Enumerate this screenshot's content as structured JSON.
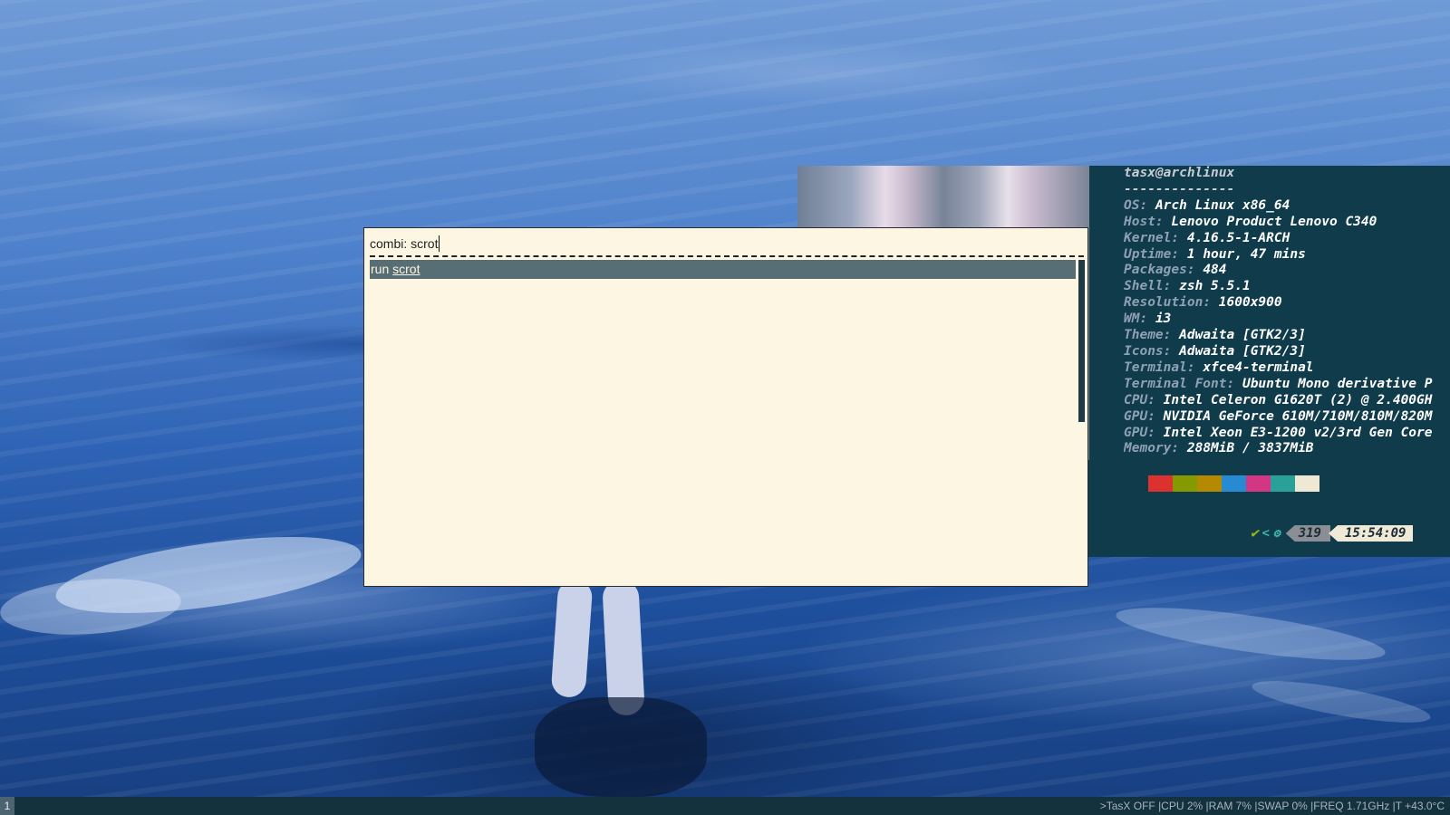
{
  "rofi": {
    "input_prefix": "combi:",
    "input_value": "scrot",
    "result_prefix": "run",
    "result_match": "scrot"
  },
  "terminal": {
    "user_host": "tasx@archlinux",
    "separator": "--------------",
    "info": [
      {
        "key": "OS",
        "value": "Arch Linux x86_64"
      },
      {
        "key": "Host",
        "value": "Lenovo Product Lenovo C340"
      },
      {
        "key": "Kernel",
        "value": "4.16.5-1-ARCH"
      },
      {
        "key": "Uptime",
        "value": "1 hour, 47 mins"
      },
      {
        "key": "Packages",
        "value": "484"
      },
      {
        "key": "Shell",
        "value": "zsh 5.5.1"
      },
      {
        "key": "Resolution",
        "value": "1600x900"
      },
      {
        "key": "WM",
        "value": "i3"
      },
      {
        "key": "Theme",
        "value": "Adwaita [GTK2/3]"
      },
      {
        "key": "Icons",
        "value": "Adwaita [GTK2/3]"
      },
      {
        "key": "Terminal",
        "value": "xfce4-terminal"
      },
      {
        "key": "Terminal Font",
        "value": "Ubuntu Mono derivative P"
      },
      {
        "key": "CPU",
        "value": "Intel Celeron G1620T (2) @ 2.400GH"
      },
      {
        "key": "GPU",
        "value": "NVIDIA GeForce 610M/710M/810M/820M"
      },
      {
        "key": "GPU",
        "value": "Intel Xeon E3-1200 v2/3rd Gen Core"
      },
      {
        "key": "Memory",
        "value": "288MiB / 3837MiB"
      }
    ],
    "colors": [
      "#0f3b4b",
      "#dc322f",
      "#859900",
      "#b58900",
      "#268bd2",
      "#d33682",
      "#2aa198",
      "#eee8d5"
    ],
    "prompt": {
      "check": "✔",
      "chevron": "<",
      "gear_icon": "⚙",
      "history_num": "319",
      "time": "15:54:09"
    }
  },
  "bar": {
    "workspace": "1",
    "status": ">TasX OFF |CPU  2% |RAM  7% |SWAP  0% |FREQ 1.71GHz |T +43.0°C"
  }
}
